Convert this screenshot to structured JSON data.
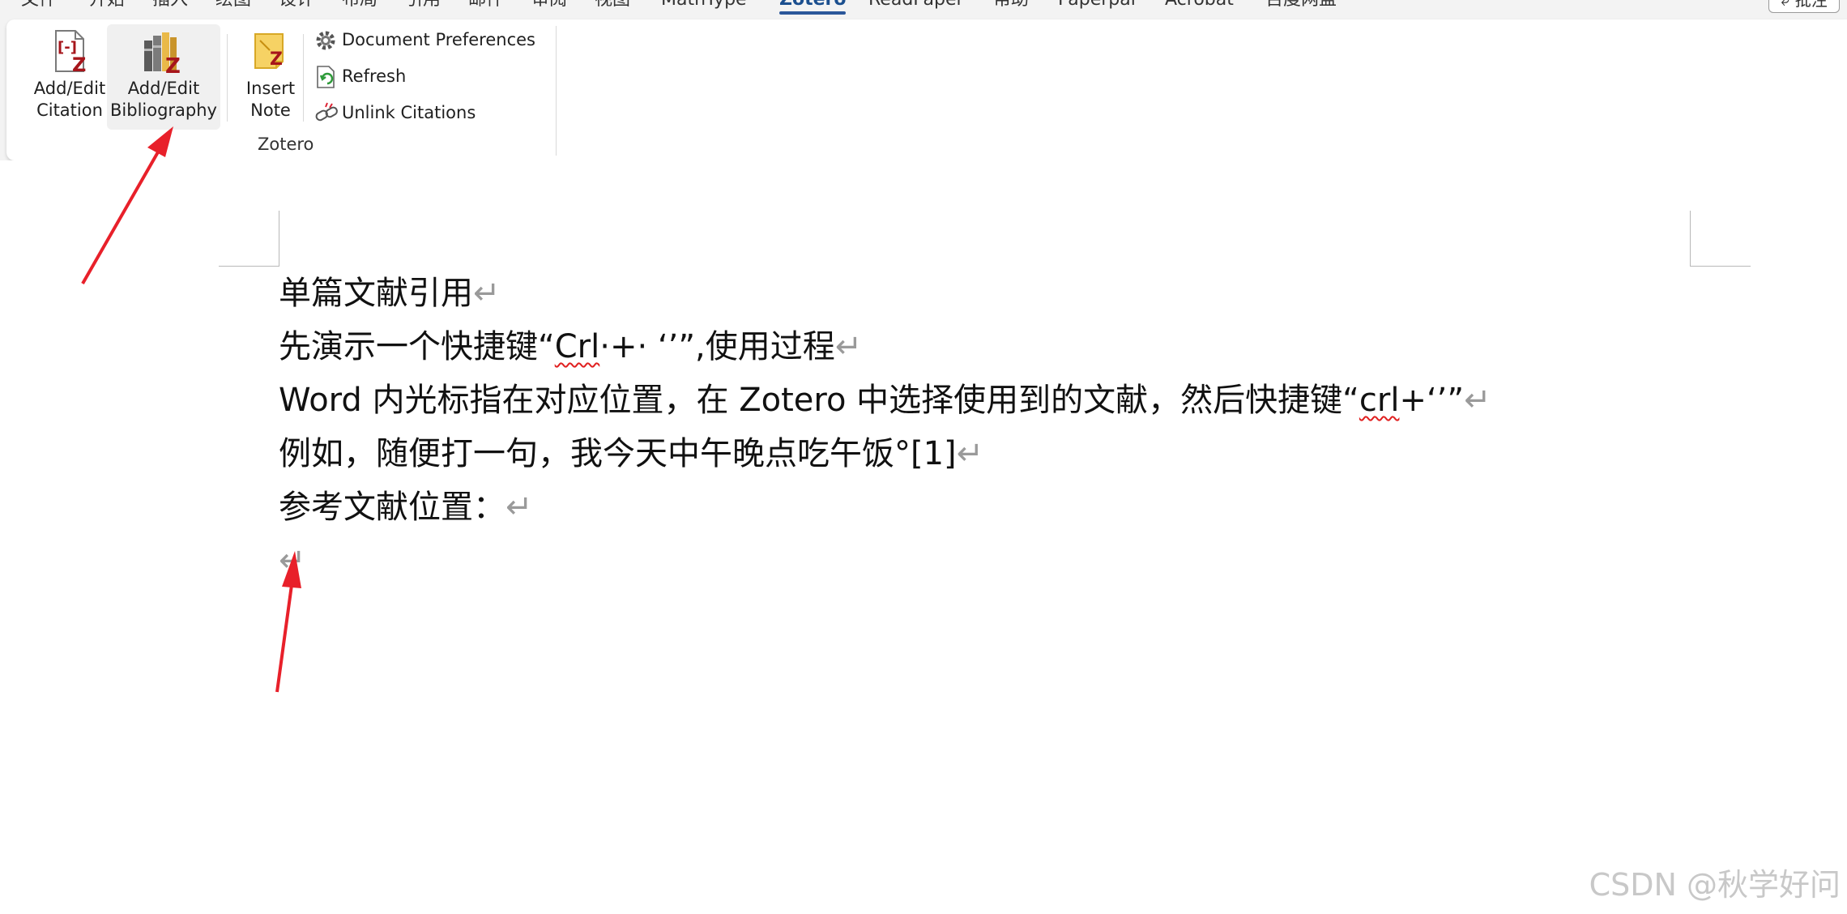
{
  "menu_tabs": [
    "文件",
    "开始",
    "插入",
    "绘图",
    "设计",
    "布局",
    "引用",
    "邮件",
    "审阅",
    "视图",
    "MathType",
    "Zotero",
    "ReadPaper",
    "帮助",
    "Paperpal",
    "Acrobat",
    "百度网盘"
  ],
  "active_tab": "Zotero",
  "comment_button": "批注",
  "ribbon": {
    "add_edit_citation": "Add/Edit\nCitation",
    "add_edit_bibliography": "Add/Edit\nBibliography",
    "insert_note": "Insert\nNote",
    "document_preferences": "Document Preferences",
    "refresh": "Refresh",
    "unlink_citations": "Unlink Citations",
    "group_label": "Zotero"
  },
  "document": {
    "line1": "单篇文献引用",
    "line2_prefix": "先演示一个快捷键“",
    "line2_squiggle": "Crl",
    "line2_suffix": "·+· ‘’”,使用过程",
    "line3_prefix": "Word 内光标指在对应位置，在 Zotero 中选择使用到的文献，然后快捷键“",
    "line3_squiggle": "crl",
    "line3_suffix": "+‘’”",
    "line4": "例如，随便打一句，我今天中午晚点吃午饭°[1]",
    "line5": "参考文献位置：",
    "paragraph_mark": "↵"
  },
  "watermark": "CSDN @秋学好问",
  "colors": {
    "zotero_red": "#a6151b",
    "arrow_red": "#e8202a",
    "active_tab_blue": "#2b579a"
  }
}
